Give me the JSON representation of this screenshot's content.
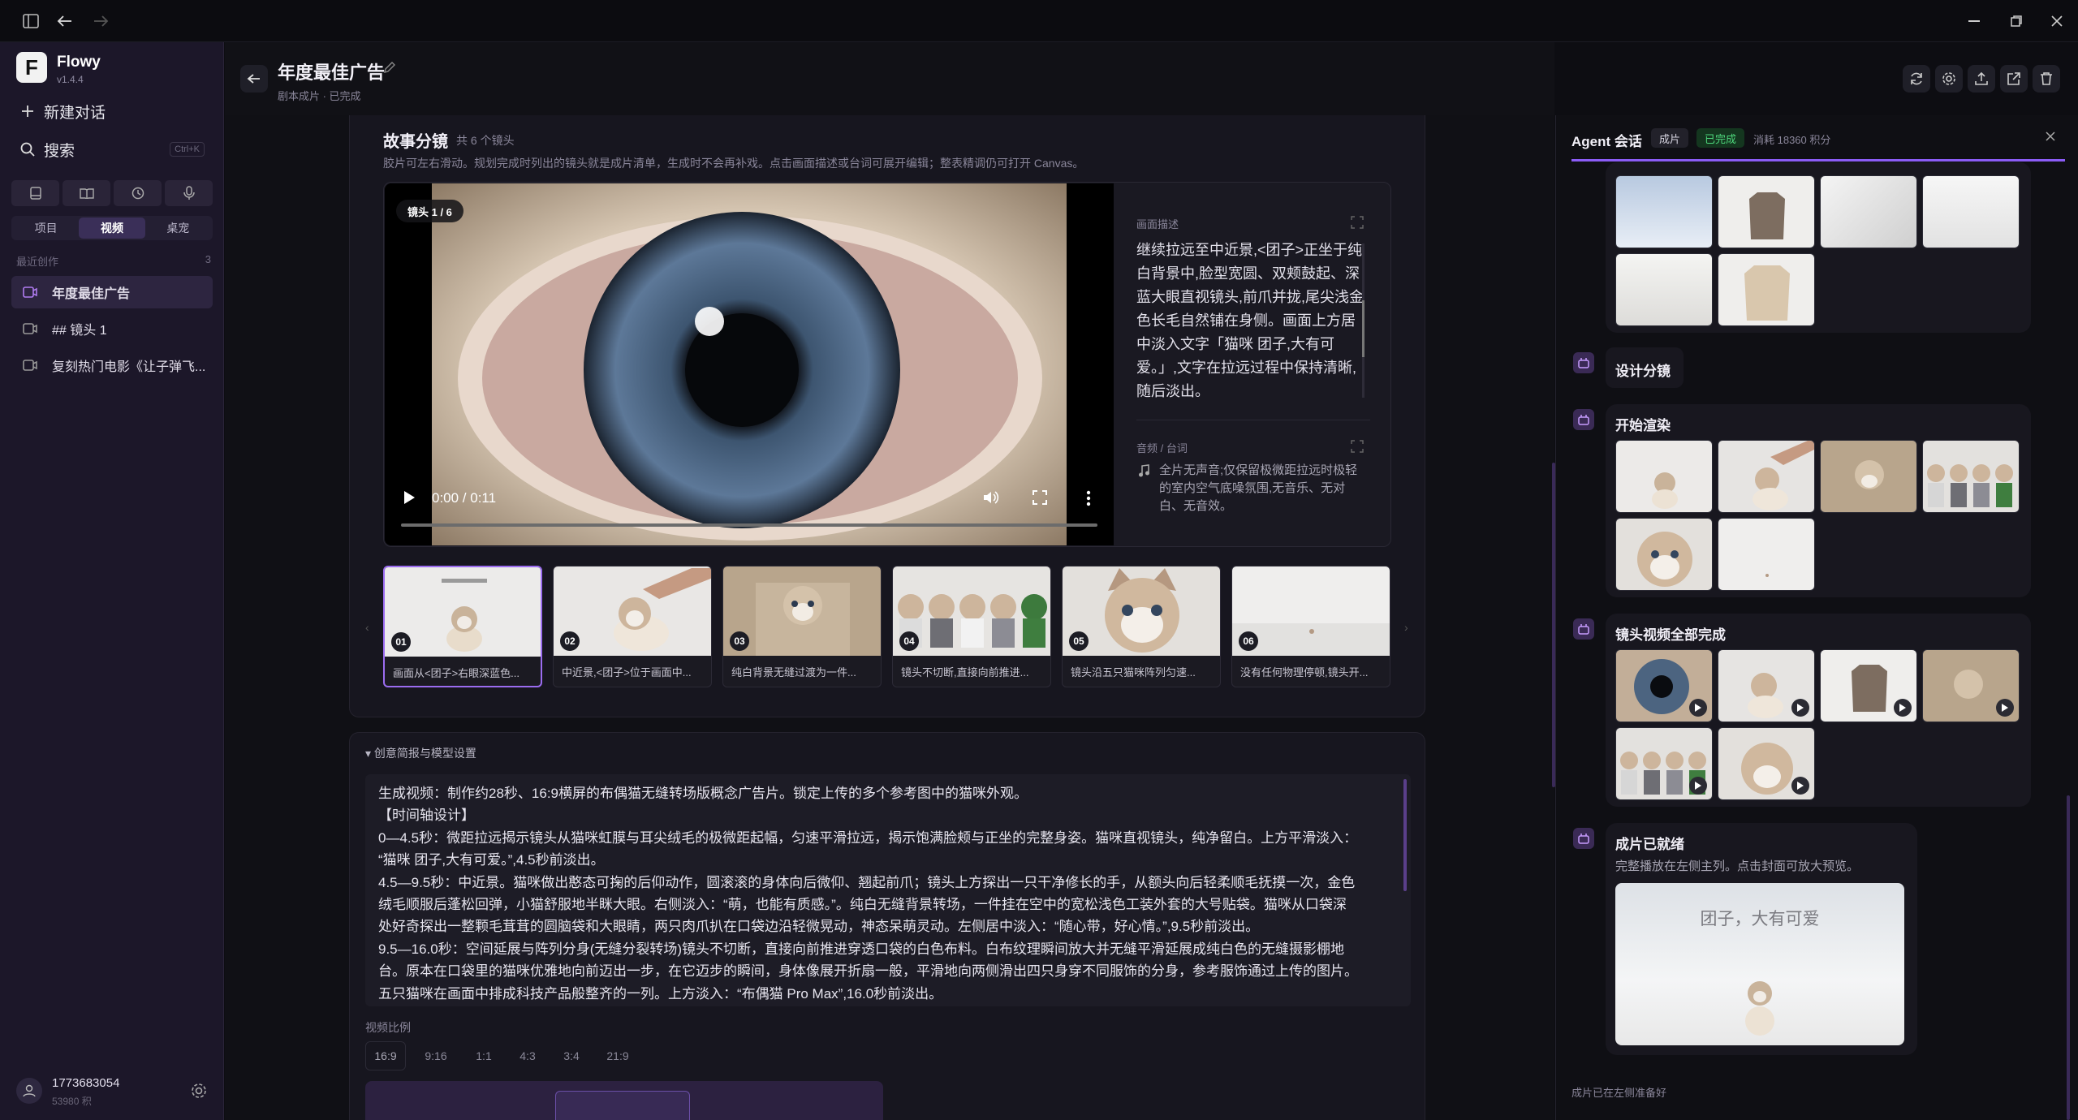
{
  "app": {
    "name": "Flowy",
    "version": "v1.4.4"
  },
  "sidebar": {
    "new_chat": "新建对话",
    "search": "搜索",
    "search_shortcut": "Ctrl+K",
    "tabs": [
      "项目",
      "视频",
      "桌宠"
    ],
    "recent_label": "最近创作",
    "recent_count": "3",
    "recent_items": [
      "年度最佳广告",
      "## 镜头 1",
      "复刻热门电影《让子弹飞..."
    ],
    "user_id": "1773683054",
    "user_credits": "53980 积"
  },
  "header": {
    "title": "年度最佳广告",
    "subtitle": "剧本成片 · 已完成"
  },
  "storyboard": {
    "title": "故事分镜",
    "count": "共 6 个镜头",
    "hint": "胶片可左右滑动。规划完成时列出的镜头就是成片清单，生成时不会再补戏。点击画面描述或台词可展开编辑；整表精调仍可打开 Canvas。",
    "shot_badge": "镜头 1 / 6",
    "video_time": "0:00 / 0:11",
    "desc_label": "画面描述",
    "desc_text": "继续拉远至中近景,<团子>正坐于纯白背景中,脸型宽圆、双颊鼓起、深蓝大眼直视镜头,前爪并拢,尾尖浅金色长毛自然铺在身侧。画面上方居中淡入文字「猫咪 团子,大有可爱。」,文字在拉远过程中保持清晰,随后淡出。",
    "audio_label": "音频 / 台词",
    "audio_text": "全片无声音;仅保留极微距拉远时极轻的室内空气底噪氛围,无音乐、无对白、无音效。",
    "thumbs": [
      {
        "num": "01",
        "cap": "画面从<团子>右眼深蓝色..."
      },
      {
        "num": "02",
        "cap": "中近景,<团子>位于画面中..."
      },
      {
        "num": "03",
        "cap": "纯白背景无缝过渡为一件..."
      },
      {
        "num": "04",
        "cap": "镜头不切断,直接向前推进..."
      },
      {
        "num": "05",
        "cap": "镜头沿五只猫咪阵列匀速..."
      },
      {
        "num": "06",
        "cap": "没有任何物理停顿,镜头开..."
      }
    ]
  },
  "brief": {
    "toggle": "▾ 创意简报与模型设置",
    "lines": [
      "生成视频：制作约28秒、16:9横屏的布偶猫无缝转场版概念广告片。锁定上传的多个参考图中的猫咪外观。",
      "【时间轴设计】",
      "0—4.5秒：微距拉远揭示镜头从猫咪虹膜与耳尖绒毛的极微距起幅，匀速平滑拉远，揭示饱满脸颊与正坐的完整身姿。猫咪直视镜头，纯净留白。上方平滑淡入：",
      "“猫咪 团子,大有可爱。”,4.5秒前淡出。",
      "4.5—9.5秒：中近景。猫咪做出憨态可掬的后仰动作，圆滚滚的身体向后微仰、翘起前爪；镜头上方探出一只干净修长的手，从额头向后轻柔顺毛抚摸一次，金色",
      "绒毛顺服后蓬松回弹，小猫舒服地半眯大眼。右侧淡入：“萌，也能有质感。”。纯白无缝背景转场，一件挂在空中的宽松浅色工装外套的大号贴袋。猫咪从口袋深",
      "处好奇探出一整颗毛茸茸的圆脑袋和大眼睛，两只肉爪扒在口袋边沿轻微晃动，神态呆萌灵动。左侧居中淡入：“随心带，好心情。”,9.5秒前淡出。",
      "9.5—16.0秒：空间延展与阵列分身(无缝分裂转场)镜头不切断，直接向前推进穿透口袋的白色布料。白布纹理瞬间放大并无缝平滑延展成纯白色的无缝摄影棚地",
      "台。原本在口袋里的猫咪优雅地向前迈出一步，在它迈步的瞬间，身体像展开折扇一般，平滑地向两侧滑出四只身穿不同服饰的分身，参考服饰通过上传的图片。",
      "五只猫咪在画面中排成科技产品般整齐的一列。上方淡入：“布偶猫 Pro Max”,16.0秒前淡出。"
    ],
    "ratio_label": "视频比例",
    "ratios": [
      "16:9",
      "9:16",
      "1:1",
      "4:3",
      "3:4",
      "21:9"
    ]
  },
  "agent": {
    "title": "Agent 会话",
    "tab": "成片",
    "status": "已完成",
    "cost": "消耗 18360 积分",
    "step_design": "设计分镜",
    "step_render": "开始渲染",
    "step_videos": "镜头视频全部完成",
    "step_final": "成片已就绪",
    "final_desc": "完整播放在左侧主列。点击封面可放大预览。",
    "final_cover_text": "团子，大有可爱",
    "footer": "成片已在左侧准备好"
  }
}
